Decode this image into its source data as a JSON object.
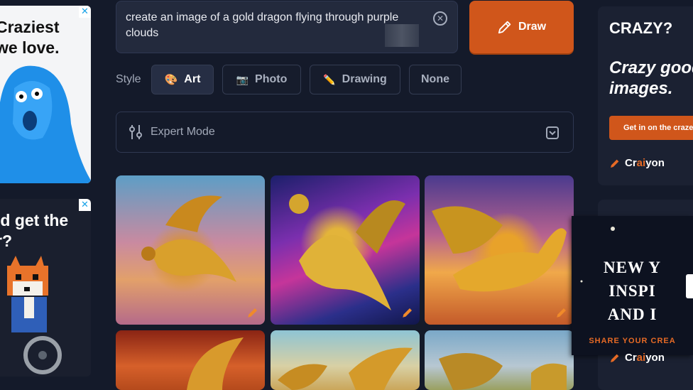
{
  "ads": {
    "left_top": {
      "text": "Craziest\nwe love.",
      "close": "✕"
    },
    "left_bottom": {
      "text": "ld get the\nr?",
      "close": "✕"
    }
  },
  "prompt": {
    "value": "create an image of a gold dragon flying through purple clouds",
    "clear_icon": "⊗"
  },
  "draw_button": {
    "label": "Draw",
    "icon": "pencil-icon",
    "color": "#d0561b"
  },
  "style": {
    "label": "Style",
    "options": [
      {
        "label": "Art",
        "icon": "🎨",
        "active": true
      },
      {
        "label": "Photo",
        "icon": "📷",
        "active": false
      },
      {
        "label": "Drawing",
        "icon": "✏️",
        "active": false
      },
      {
        "label": "None",
        "icon": "",
        "active": false
      }
    ]
  },
  "expert_mode": {
    "label": "Expert Mode"
  },
  "results": {
    "images": [
      {
        "alt": "gold dragon over pink and blue sky"
      },
      {
        "alt": "gold dragon in purple nebula clouds"
      },
      {
        "alt": "gold dragon over sunset clouds"
      },
      {
        "alt": "gold dragon red sky"
      },
      {
        "alt": "gold dragons over pale sky"
      },
      {
        "alt": "gold dragon over cloudy sky"
      }
    ]
  },
  "promo": {
    "title": "CRAZY?",
    "tagline": "Crazy good\nimages.",
    "button": "Get in on the craze",
    "brand_prefix": "Cr",
    "brand_ai": "ai",
    "brand_suffix": "yon"
  },
  "popup": {
    "headline": "NEW Y\nINSPI\nAND I",
    "cta": "SHARE YOUR CREA",
    "brand_prefix": "Cr",
    "brand_ai": "ai",
    "brand_suffix": "yon"
  }
}
